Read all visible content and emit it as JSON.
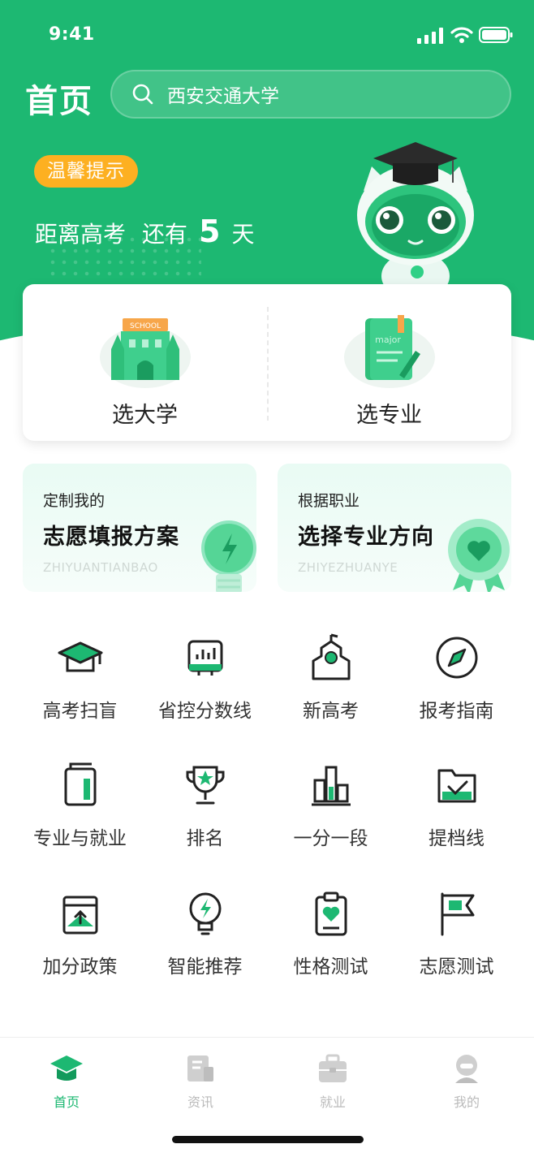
{
  "status_bar": {
    "time": "9:41"
  },
  "header": {
    "title": "首页",
    "search_text": "西安交通大学",
    "tip_badge": "温馨提示",
    "countdown_prefix": "距离高考",
    "countdown_mid": "还有",
    "countdown_days": "5",
    "countdown_suffix": "天",
    "brand_color": "#1db872",
    "badge_color": "#fdb021"
  },
  "choose": {
    "left_label": "选大学",
    "right_label": "选专业",
    "school_sign": "SCHOOL",
    "major_sign": "major"
  },
  "banners": [
    {
      "small": "定制我的",
      "big": "志愿填报方案",
      "en": "ZHIYUANTIANBAO",
      "icon": "lightbulb-icon"
    },
    {
      "small": "根据职业",
      "big": "选择专业方向",
      "en": "ZHIYEZHUANYE",
      "icon": "medal-icon"
    }
  ],
  "grid": [
    {
      "label": "高考扫盲",
      "icon": "graduation-cap-icon"
    },
    {
      "label": "省控分数线",
      "icon": "score-chart-icon"
    },
    {
      "label": "新高考",
      "icon": "school-building-icon"
    },
    {
      "label": "报考指南",
      "icon": "compass-icon"
    },
    {
      "label": "专业与就业",
      "icon": "book-icon"
    },
    {
      "label": "排名",
      "icon": "trophy-icon"
    },
    {
      "label": "一分一段",
      "icon": "bar-chart-icon"
    },
    {
      "label": "提档线",
      "icon": "folder-check-icon"
    },
    {
      "label": "加分政策",
      "icon": "upload-card-icon"
    },
    {
      "label": "智能推荐",
      "icon": "smart-bulb-icon"
    },
    {
      "label": "性格测试",
      "icon": "heart-clipboard-icon"
    },
    {
      "label": "志愿测试",
      "icon": "flag-icon"
    }
  ],
  "tabbar": [
    {
      "label": "首页",
      "icon": "home-cap-icon",
      "active": true
    },
    {
      "label": "资讯",
      "icon": "news-icon",
      "active": false
    },
    {
      "label": "就业",
      "icon": "briefcase-icon",
      "active": false
    },
    {
      "label": "我的",
      "icon": "profile-icon",
      "active": false
    }
  ]
}
